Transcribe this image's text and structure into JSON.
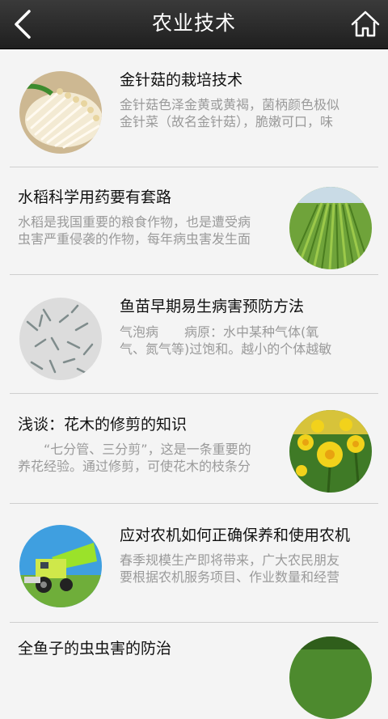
{
  "header": {
    "title": "农业技术"
  },
  "articles": [
    {
      "title": "金针菇的栽培技术",
      "desc1": "金针菇色泽金黄或黄褐，菌柄颜色极似",
      "desc2": "金针菜（故名金针菇），脆嫩可口，味",
      "image": "enoki-mushroom"
    },
    {
      "title": "水稻科学用药要有套路",
      "desc1": "水稻是我国重要的粮食作物，也是遭受病",
      "desc2": "虫害严重侵袭的作物，每年病虫害发生面",
      "image": "rice-field"
    },
    {
      "title": "鱼苗早期易生病害预防方法",
      "desc1": "气泡病　　病原：水中某种气体(氧",
      "desc2": "气、氮气等)过饱和。越小的个体越敏",
      "image": "fish-fry"
    },
    {
      "title": "浅谈：花木的修剪的知识",
      "desc1": "　　“七分管、三分剪”，这是一条重要的",
      "desc2": "养花经验。通过修剪，可使花木的枝条分",
      "image": "daffodils"
    },
    {
      "title": "应对农机如何正确保养和使用农机",
      "desc1": "春季规模生产即将带来，广大农民朋友",
      "desc2": "要根据农机服务项目、作业数量和经营",
      "image": "harvester"
    },
    {
      "title": "全鱼子的虫虫害的防治",
      "desc1": "",
      "desc2": "",
      "image": "plant"
    }
  ]
}
